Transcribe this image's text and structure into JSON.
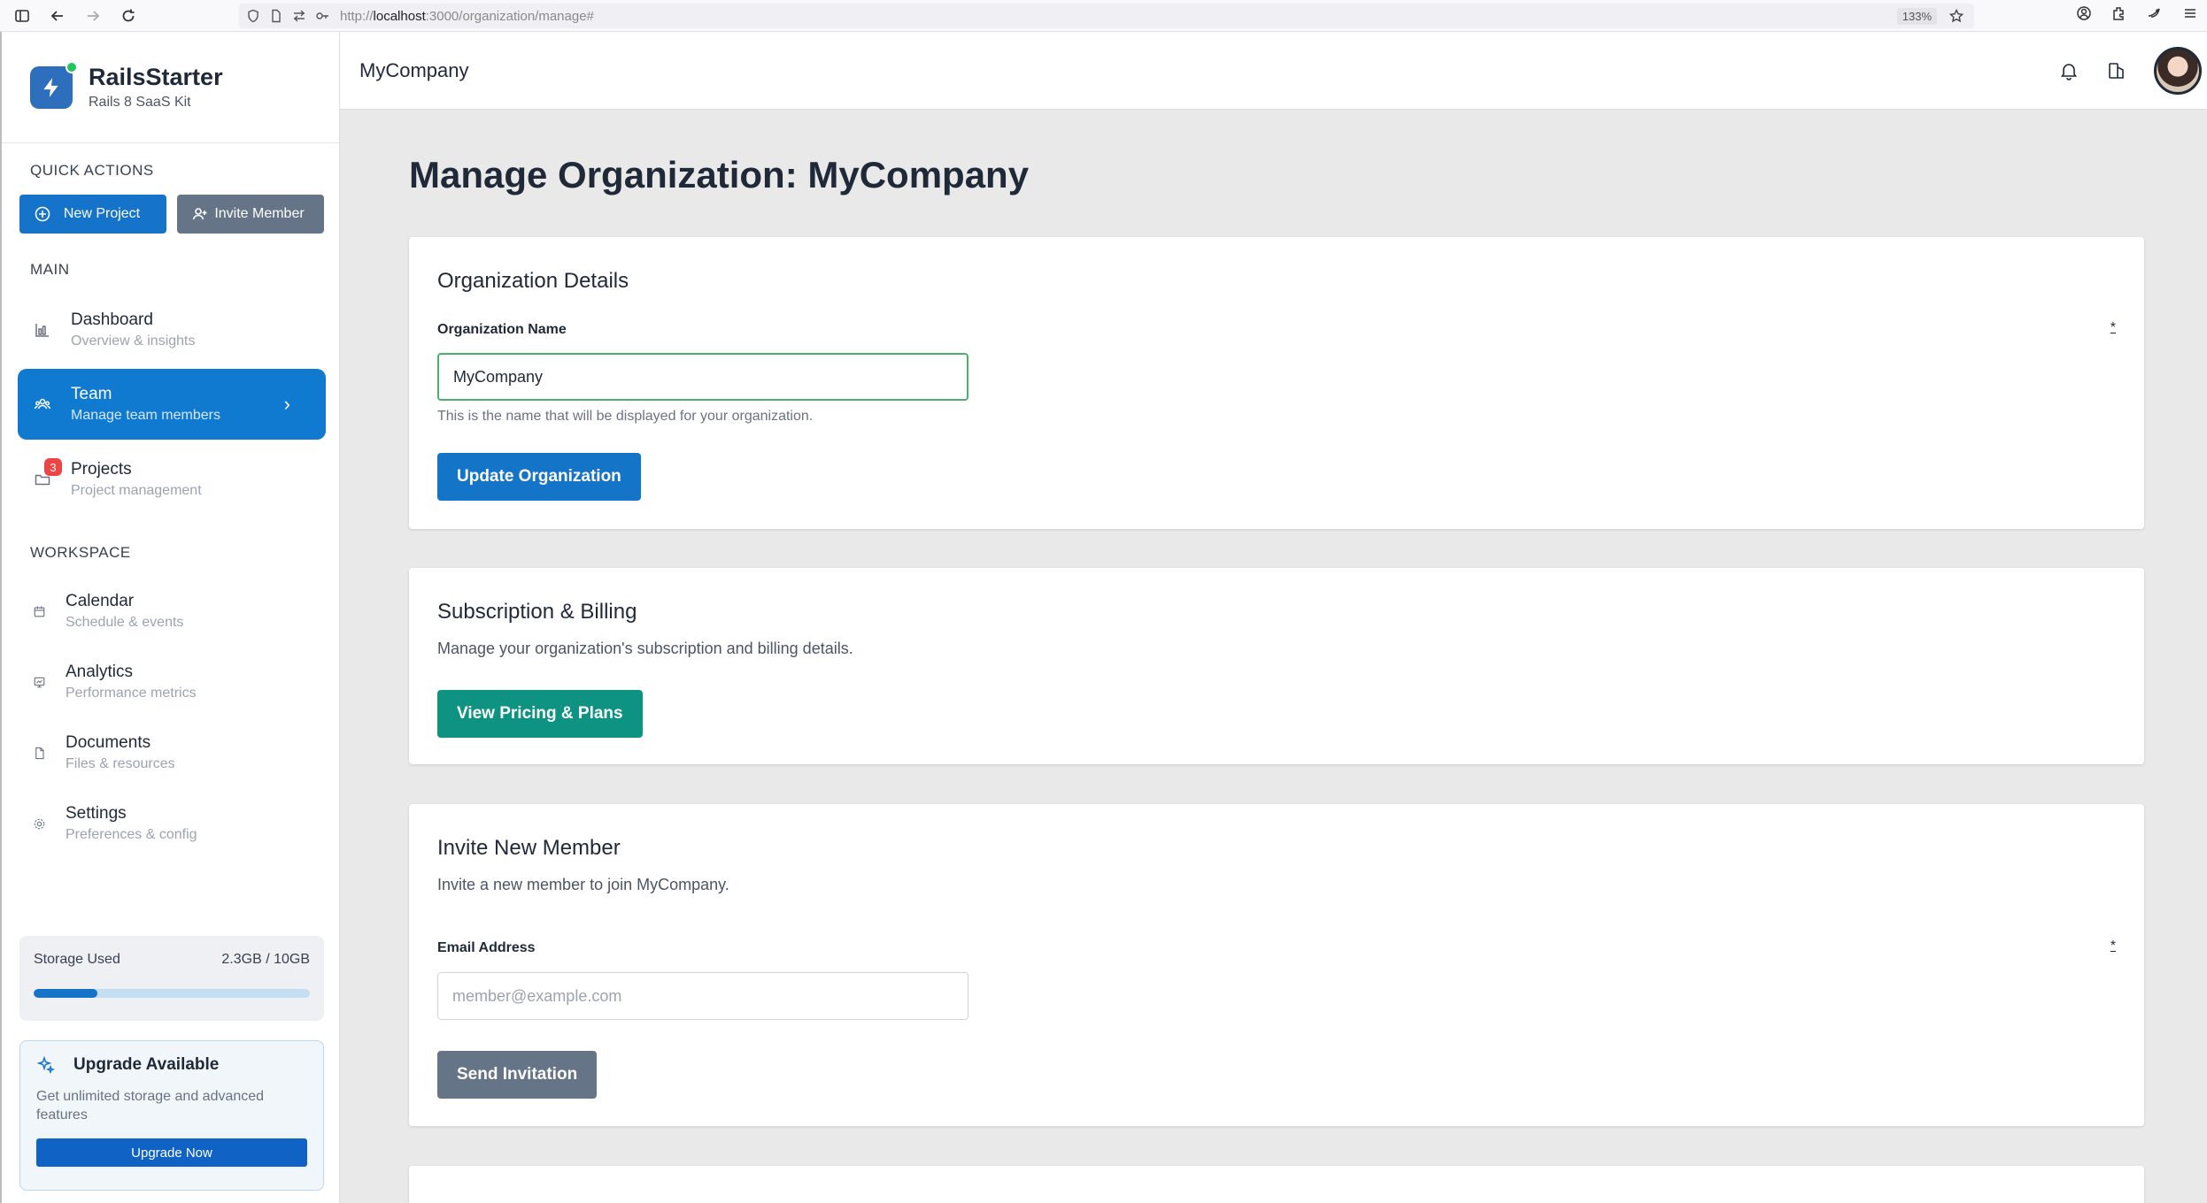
{
  "browser": {
    "url_prefix": "http://",
    "url_host": "localhost",
    "url_path": ":3000/organization/manage#",
    "zoom": "133%"
  },
  "brand": {
    "title": "RailsStarter",
    "subtitle": "Rails 8 SaaS Kit"
  },
  "sidebar": {
    "quick_actions_label": "QUICK ACTIONS",
    "new_project_label": "New Project",
    "invite_member_label": "Invite Member",
    "main_label": "MAIN",
    "workspace_label": "WORKSPACE",
    "main_items": [
      {
        "title": "Dashboard",
        "sub": "Overview & insights"
      },
      {
        "title": "Team",
        "sub": "Manage team members"
      },
      {
        "title": "Projects",
        "sub": "Project management",
        "badge": "3"
      }
    ],
    "workspace_items": [
      {
        "title": "Calendar",
        "sub": "Schedule & events"
      },
      {
        "title": "Analytics",
        "sub": "Performance metrics"
      },
      {
        "title": "Documents",
        "sub": "Files & resources"
      },
      {
        "title": "Settings",
        "sub": "Preferences & config"
      }
    ],
    "storage": {
      "label": "Storage Used",
      "value": "2.3GB / 10GB",
      "fraction": 0.23
    },
    "upgrade": {
      "title": "Upgrade Available",
      "desc": "Get unlimited storage and advanced features",
      "button": "Upgrade Now"
    }
  },
  "header": {
    "org_name": "MyCompany"
  },
  "main": {
    "page_title": "Manage Organization: MyCompany",
    "details_card": {
      "title": "Organization Details",
      "field_label": "Organization Name",
      "required_mark": "*",
      "field_value": "MyCompany",
      "help": "This is the name that will be displayed for your organization.",
      "button": "Update Organization"
    },
    "billing_card": {
      "title": "Subscription & Billing",
      "desc": "Manage your organization's subscription and billing details.",
      "button": "View Pricing & Plans"
    },
    "invite_card": {
      "title": "Invite New Member",
      "desc": "Invite a new member to join MyCompany.",
      "field_label": "Email Address",
      "required_mark": "*",
      "placeholder": "member@example.com",
      "button": "Send Invitation"
    }
  },
  "colors": {
    "primary": "#1474c8",
    "teal": "#0e9382",
    "slate": "#667487",
    "badge": "#ef4444"
  }
}
